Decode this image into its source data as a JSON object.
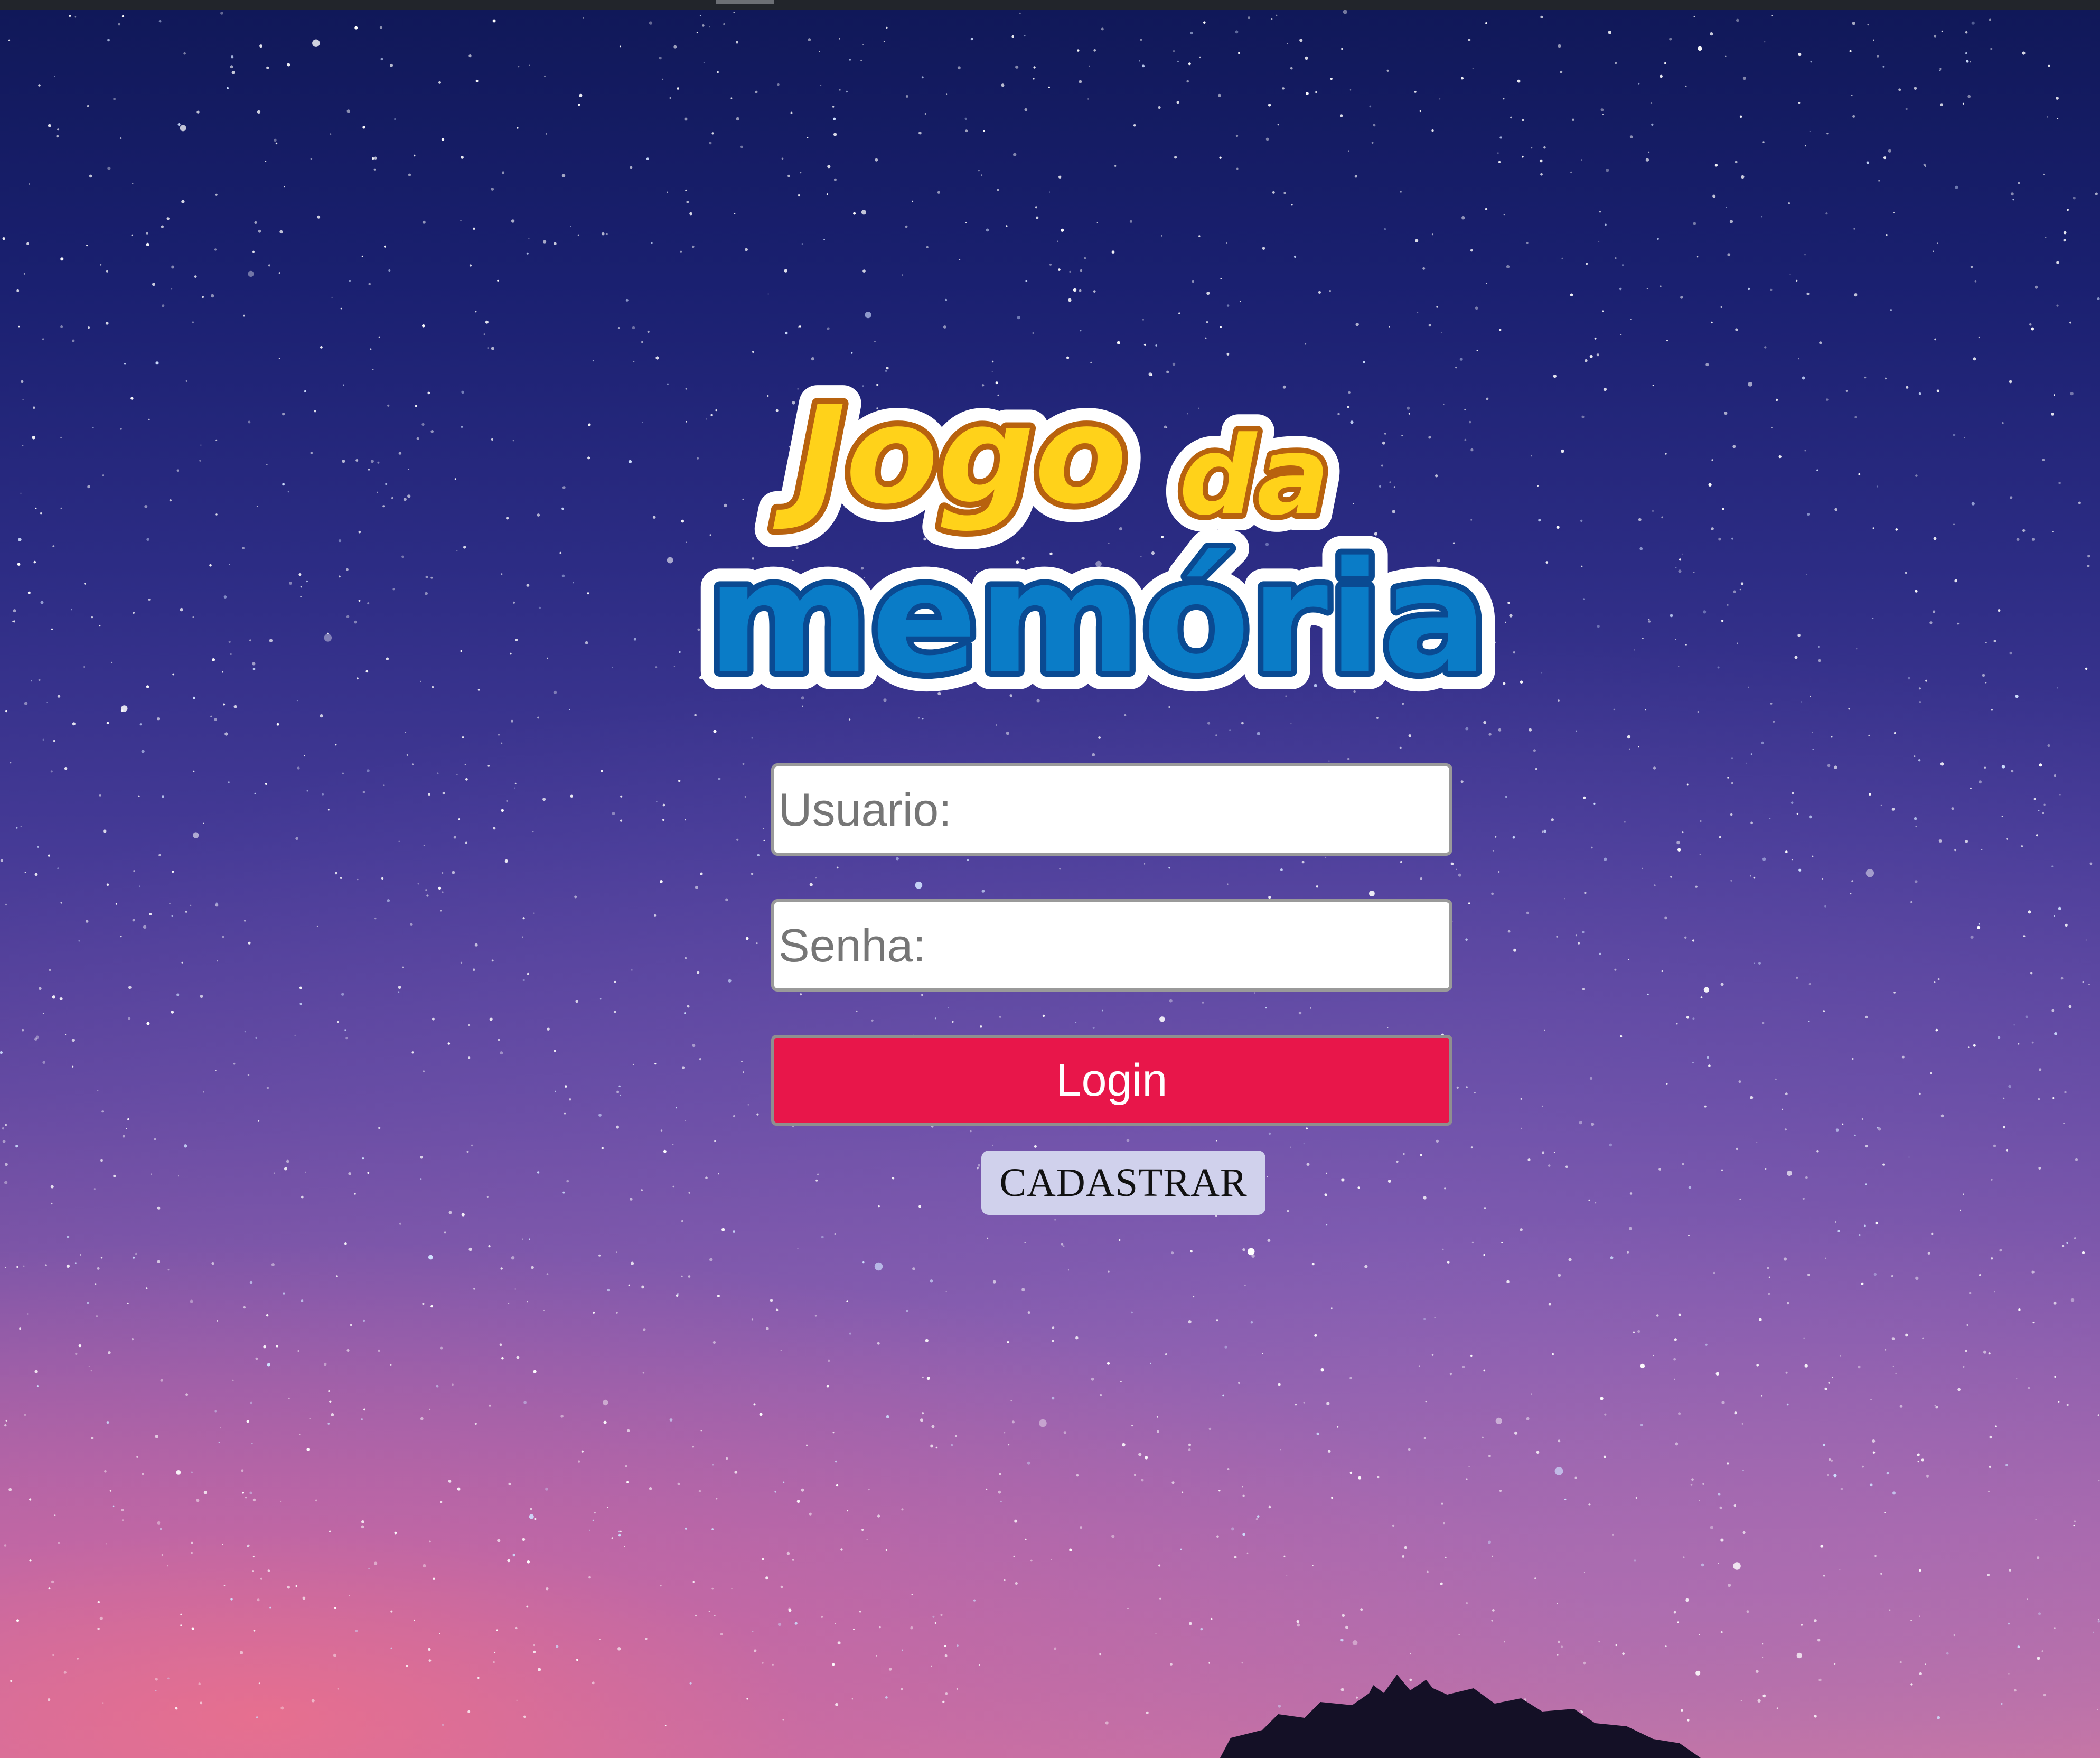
{
  "logo": {
    "line1": "Jogo",
    "line1b": "da",
    "line2": "memória",
    "colors": {
      "yellow": "#ffd21a",
      "orange_outline": "#b8620e",
      "blue": "#0a7cc7",
      "blue_outline": "#0a4a92",
      "white_outline": "#ffffff"
    }
  },
  "form": {
    "username_placeholder": "Usuario:",
    "password_placeholder": "Senha:",
    "login_label": "Login",
    "register_label": "CADASTRAR"
  },
  "colors": {
    "login_button": "#e8164a",
    "register_button": "#d0d1ec",
    "sky_top": "#101858",
    "sky_bottom": "#d27aa0"
  },
  "icons": {
    "background": "starry-night-sky",
    "silhouette": "tree-silhouette"
  }
}
